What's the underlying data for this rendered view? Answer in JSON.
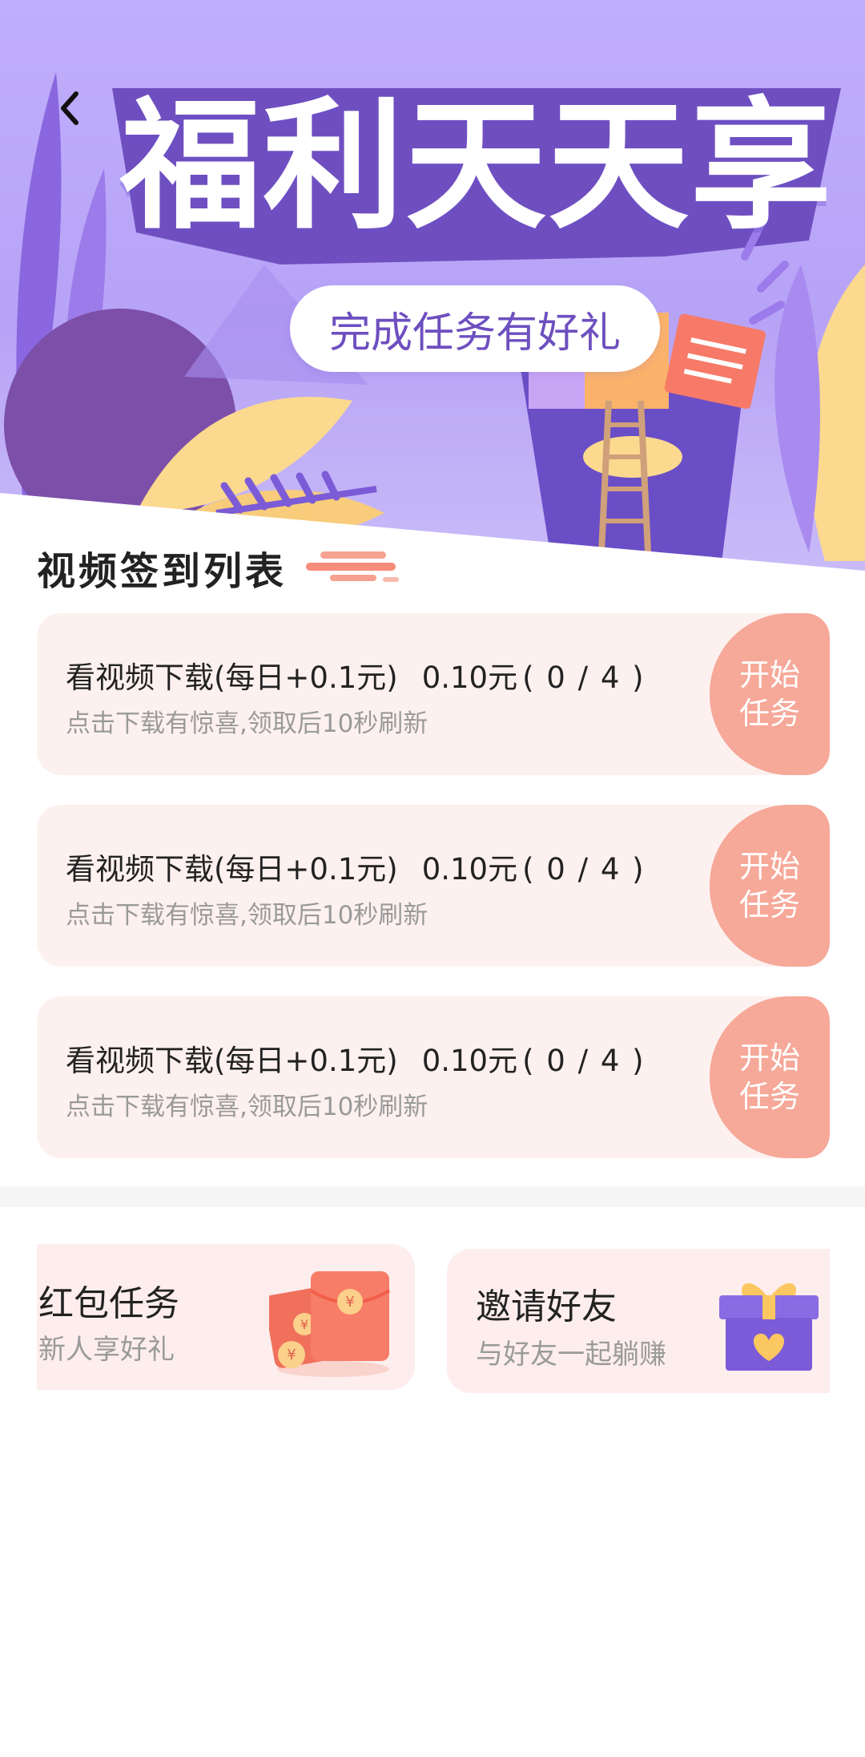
{
  "banner": {
    "title": "福利天天享",
    "subtitle": "完成任务有好礼",
    "back_icon": "chevron-left-icon"
  },
  "section": {
    "title": "视频签到列表"
  },
  "tasks": [
    {
      "title": "看视频下载(每日+0.1元)",
      "reward": "0.10元",
      "progress": "( 0 / 4 )",
      "description": "点击下载有惊喜,领取后10秒刷新",
      "button_line1": "开始",
      "button_line2": "任务"
    },
    {
      "title": "看视频下载(每日+0.1元)",
      "reward": "0.10元",
      "progress": "( 0 / 4 )",
      "description": "点击下载有惊喜,领取后10秒刷新",
      "button_line1": "开始",
      "button_line2": "任务"
    },
    {
      "title": "看视频下载(每日+0.1元)",
      "reward": "0.10元",
      "progress": "( 0 / 4 )",
      "description": "点击下载有惊喜,领取后10秒刷新",
      "button_line1": "开始",
      "button_line2": "任务"
    }
  ],
  "promos": {
    "red_packet": {
      "title": "红包任务",
      "subtitle": "新人享好礼",
      "icon": "red-packet-icon"
    },
    "invite": {
      "title": "邀请好友",
      "subtitle": "与好友一起躺赚",
      "icon": "gift-box-icon"
    }
  },
  "colors": {
    "banner_bg": "#bfaefc",
    "accent_purple": "#6e4fbf",
    "card_bg": "#fdf1ef",
    "task_button": "#f6a899",
    "muted_text": "#9a9a9a",
    "primary_text": "#222222"
  }
}
